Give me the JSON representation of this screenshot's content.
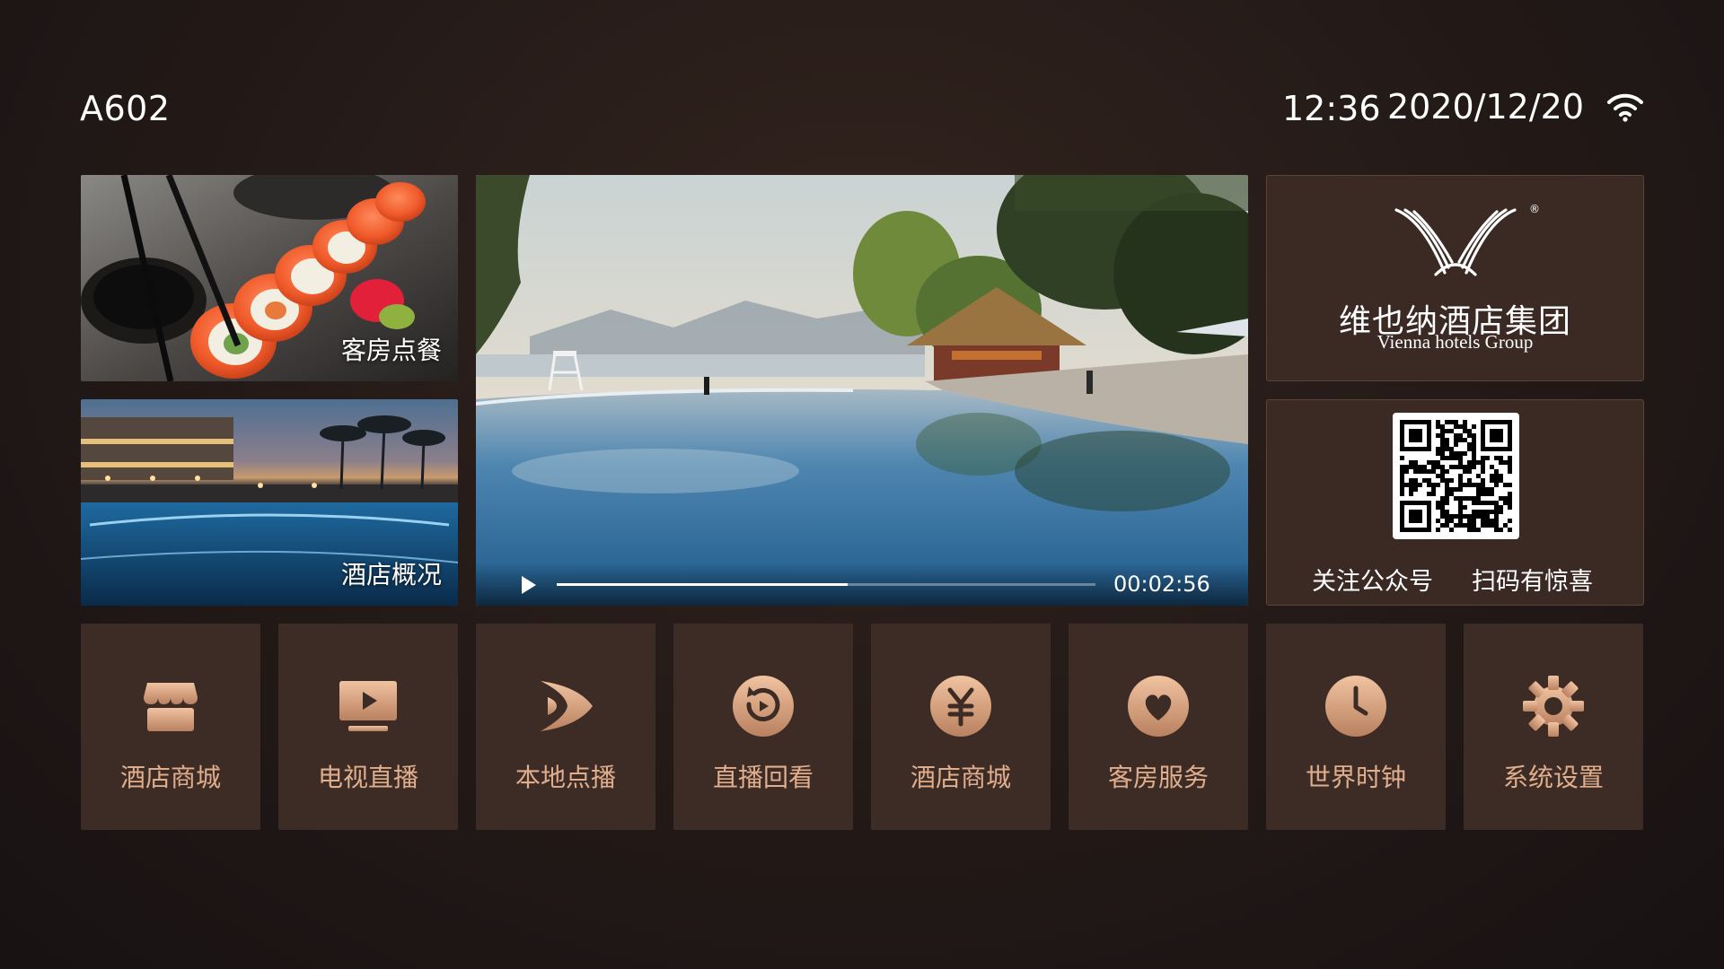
{
  "header": {
    "room_number": "A602",
    "time": "12:36",
    "date": "2020/12/20",
    "wifi_icon": "wifi-icon"
  },
  "tiles": {
    "dining_label": "客房点餐",
    "overview_label": "酒店概况"
  },
  "video": {
    "play_icon": "play-icon",
    "progress": 0.54,
    "elapsed": "00:02:56"
  },
  "brand": {
    "name_cn": "维也纳酒店集团",
    "name_en": "Vienna hotels Group",
    "registered_mark": "®"
  },
  "promo": {
    "follow_text": "关注公众号",
    "scan_text": "扫码有惊喜"
  },
  "menu": [
    {
      "label": "酒店商城",
      "icon": "store-icon"
    },
    {
      "label": "电视直播",
      "icon": "tv-icon"
    },
    {
      "label": "本地点播",
      "icon": "vod-play-icon"
    },
    {
      "label": "直播回看",
      "icon": "replay-icon"
    },
    {
      "label": "酒店商城",
      "icon": "yuan-icon"
    },
    {
      "label": "客房服务",
      "icon": "heart-icon"
    },
    {
      "label": "世界时钟",
      "icon": "clock-icon"
    },
    {
      "label": "系统设置",
      "icon": "gear-icon"
    }
  ],
  "colors": {
    "accent": "#e0ae8c",
    "icon_gradient_top": "#f1c3a1",
    "icon_gradient_bottom": "#b9815f",
    "panel": "#3b2a24"
  }
}
